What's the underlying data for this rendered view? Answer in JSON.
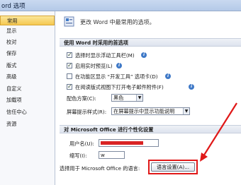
{
  "window": {
    "title": "ord 选项"
  },
  "sidebar": {
    "items": [
      {
        "label": "常用"
      },
      {
        "label": "显示"
      },
      {
        "label": "校对"
      },
      {
        "label": "保存"
      },
      {
        "label": "版式"
      },
      {
        "label": "高级"
      },
      {
        "label": "自定义"
      },
      {
        "label": "加载项"
      },
      {
        "label": "信任中心"
      },
      {
        "label": "资源"
      }
    ]
  },
  "main": {
    "header": "更改 Word 中最常用的选项。",
    "section1": {
      "title": "使用 Word 时采用的首选项",
      "options": [
        {
          "label": "选择时显示浮动工具栏(M)",
          "checked": true
        },
        {
          "label": "启用实时预览(L)",
          "checked": true
        },
        {
          "label": "在功能区显示 “开发工具” 选项卡(D)",
          "checked": false
        },
        {
          "label": "在阅读版式视图下打开电子邮件附件(F)",
          "checked": true
        }
      ],
      "color_scheme_label": "配色方案(C):",
      "color_scheme_value": "黑色",
      "screentip_label": "屏幕提示样式(R):",
      "screentip_value": "在屏幕提示中显示功能说明"
    },
    "section2": {
      "title": "对 Microsoft Office 进行个性化设置",
      "username_label": "用户名(U):",
      "initials_label": "缩写(I):",
      "initials_value": "w",
      "language_label": "选择用于 Microsoft Office 的语言:",
      "language_button": "语言设置(A)..."
    }
  },
  "colors": {
    "highlight": "#e01818",
    "selected_nav": "#f5c850"
  }
}
